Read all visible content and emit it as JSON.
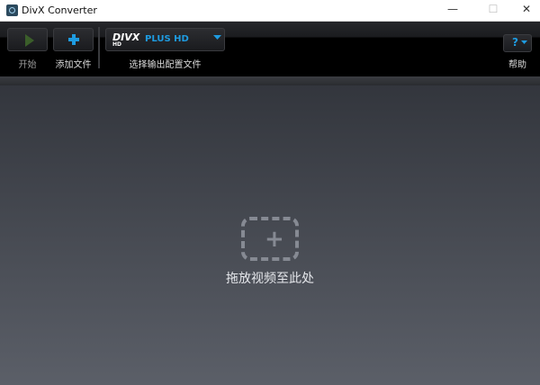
{
  "window": {
    "title": "DivX Converter",
    "minimize": "—",
    "maximize": "☐",
    "close": "✕"
  },
  "toolbar": {
    "start_label": "开始",
    "add_file_label": "添加文件",
    "profile_label": "选择输出配置文件",
    "profile_logo": "DIVX",
    "profile_logo_sub": "HD",
    "profile_value": "PLUS HD",
    "help_label": "帮助",
    "help_icon": "?"
  },
  "main": {
    "drop_text": "拖放视频至此处"
  },
  "colors": {
    "accent": "#1e9be0",
    "play": "#3b5e2a"
  }
}
